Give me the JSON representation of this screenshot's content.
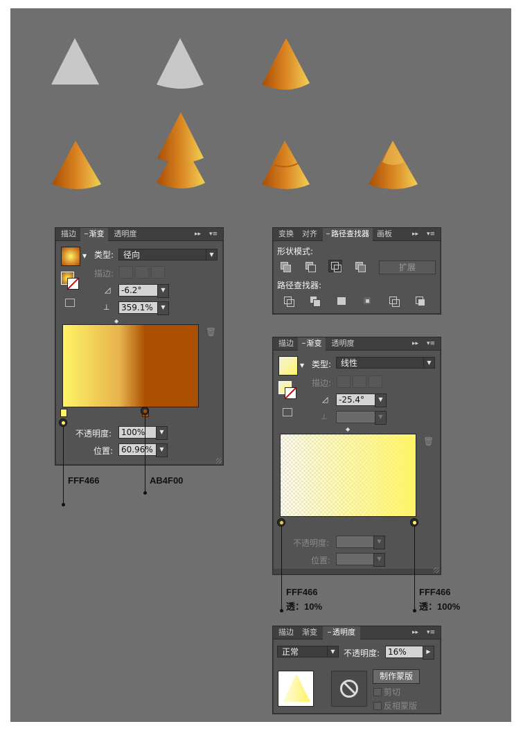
{
  "colors": {
    "canvas": "#6f6f6f",
    "panel": "#535353",
    "gradient_light": "#FFF466",
    "gradient_dark": "#AB4F00",
    "gradient_mid": "#d9a23a",
    "gray_shape": "#c8c8c8"
  },
  "gradient_panel": {
    "tabs": [
      "描边",
      "渐变",
      "透明度"
    ],
    "type_label": "类型:",
    "type_value": "径向",
    "stroke_label": "描边:",
    "angle_value": "-6.2°",
    "aspect_value": "359.1%",
    "opacity_label": "不透明度:",
    "opacity_value": "100%",
    "location_label": "位置:",
    "location_value": "60.96%",
    "stops": [
      {
        "color": "#FFF466",
        "location": 0
      },
      {
        "color": "#AB4F00",
        "location": 60.96
      }
    ]
  },
  "pathfinder_panel": {
    "tabs": [
      "变换",
      "对齐",
      "路径查找器",
      "画板"
    ],
    "shape_modes_label": "形状模式:",
    "expand_label": "扩展",
    "pathfinders_label": "路径查找器:",
    "shape_mode_icons": [
      "unite-icon",
      "minus-front-icon",
      "intersect-icon",
      "exclude-icon"
    ],
    "pathfinder_icons": [
      "divide-icon",
      "trim-icon",
      "merge-icon",
      "crop-icon",
      "outline-icon",
      "minus-back-icon"
    ]
  },
  "gradient_panel_2": {
    "tabs": [
      "描边",
      "渐变",
      "透明度"
    ],
    "type_label": "类型:",
    "type_value": "线性",
    "stroke_label": "描边:",
    "angle_value": "-25.4°",
    "opacity_label": "不透明度:",
    "location_label": "位置:",
    "stops": [
      {
        "color": "#FFF466",
        "opacity": 10
      },
      {
        "color": "#FFF466",
        "opacity": 100
      }
    ]
  },
  "transparency_panel": {
    "tabs": [
      "描边",
      "渐变",
      "透明度"
    ],
    "blend_mode": "正常",
    "opacity_label": "不透明度:",
    "opacity_value": "16%",
    "make_mask_label": "制作蒙版",
    "clip_label": "剪切",
    "invert_label": "反相蒙版"
  },
  "annotations": {
    "stop1": "FFF466",
    "stop2": "AB4F00",
    "stop3_color": "FFF466",
    "stop3_opacity": "透：10%",
    "stop4_color": "FFF466",
    "stop4_opacity": "透：100%"
  }
}
